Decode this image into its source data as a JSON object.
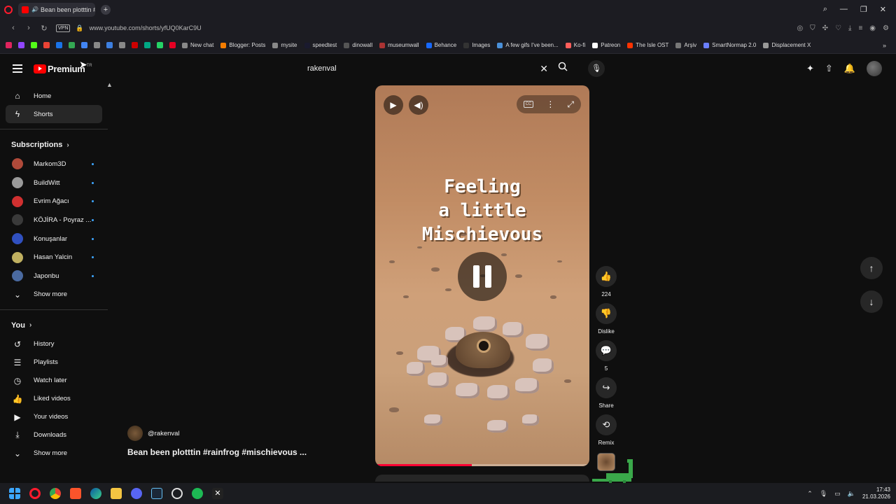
{
  "browser": {
    "tab_title": "Bean been plotttin #r",
    "url": "www.youtube.com/shorts/yfUQ0KarC9U",
    "vpn_label": "VPN",
    "bookmarks": [
      "New chat",
      "Blogger: Posts",
      "mysite",
      "speedtest",
      "dinowall",
      "museumwall",
      "Behance",
      "Images",
      "A few gifs I've been...",
      "Ko-fi",
      "Patreon",
      "The Isle OST",
      "Arşiv",
      "SmartNormap 2.0",
      "Displacement X"
    ]
  },
  "header": {
    "brand": "Premium",
    "country": "TR",
    "search_value": "rakenval"
  },
  "sidebar": {
    "home": "Home",
    "shorts": "Shorts",
    "subscriptions_title": "Subscriptions",
    "subscriptions": [
      {
        "name": "Markom3D",
        "color": "#b04a3a"
      },
      {
        "name": "BuildWitt",
        "color": "#9a9a9a"
      },
      {
        "name": "Evrim Ağacı",
        "color": "#d03030"
      },
      {
        "name": "KÖJİRA - Poyraz ...",
        "color": "#3a3a3a"
      },
      {
        "name": "Konuşanlar",
        "color": "#3050c0"
      },
      {
        "name": "Hasan Yalcin",
        "color": "#c0b060"
      },
      {
        "name": "Japonbu",
        "color": "#4a6aa0"
      }
    ],
    "show_more_1": "Show more",
    "you_title": "You",
    "you_items": [
      {
        "label": "History",
        "icon": "↺",
        "name": "history-icon"
      },
      {
        "label": "Playlists",
        "icon": "☰",
        "name": "playlists-icon"
      },
      {
        "label": "Watch later",
        "icon": "◷",
        "name": "clock-icon"
      },
      {
        "label": "Liked videos",
        "icon": "👍",
        "name": "thumbs-up-icon"
      },
      {
        "label": "Your videos",
        "icon": "▶",
        "name": "video-icon"
      },
      {
        "label": "Downloads",
        "icon": "⤓",
        "name": "download-icon"
      }
    ],
    "show_more_2": "Show more"
  },
  "video": {
    "caption_line1": "Feeling",
    "caption_line2": "a little",
    "caption_line3": "Mischievous",
    "progress_fraction": 0.45
  },
  "actions": {
    "likes": "224",
    "dislike": "Dislike",
    "comments": "5",
    "share": "Share",
    "remix": "Remix"
  },
  "channel": {
    "handle": "@rakenval",
    "title": "Bean been plotttin #rainfrog #mischievous ..."
  },
  "taskbar": {
    "time": "17:43",
    "date": "21.03.2026"
  }
}
